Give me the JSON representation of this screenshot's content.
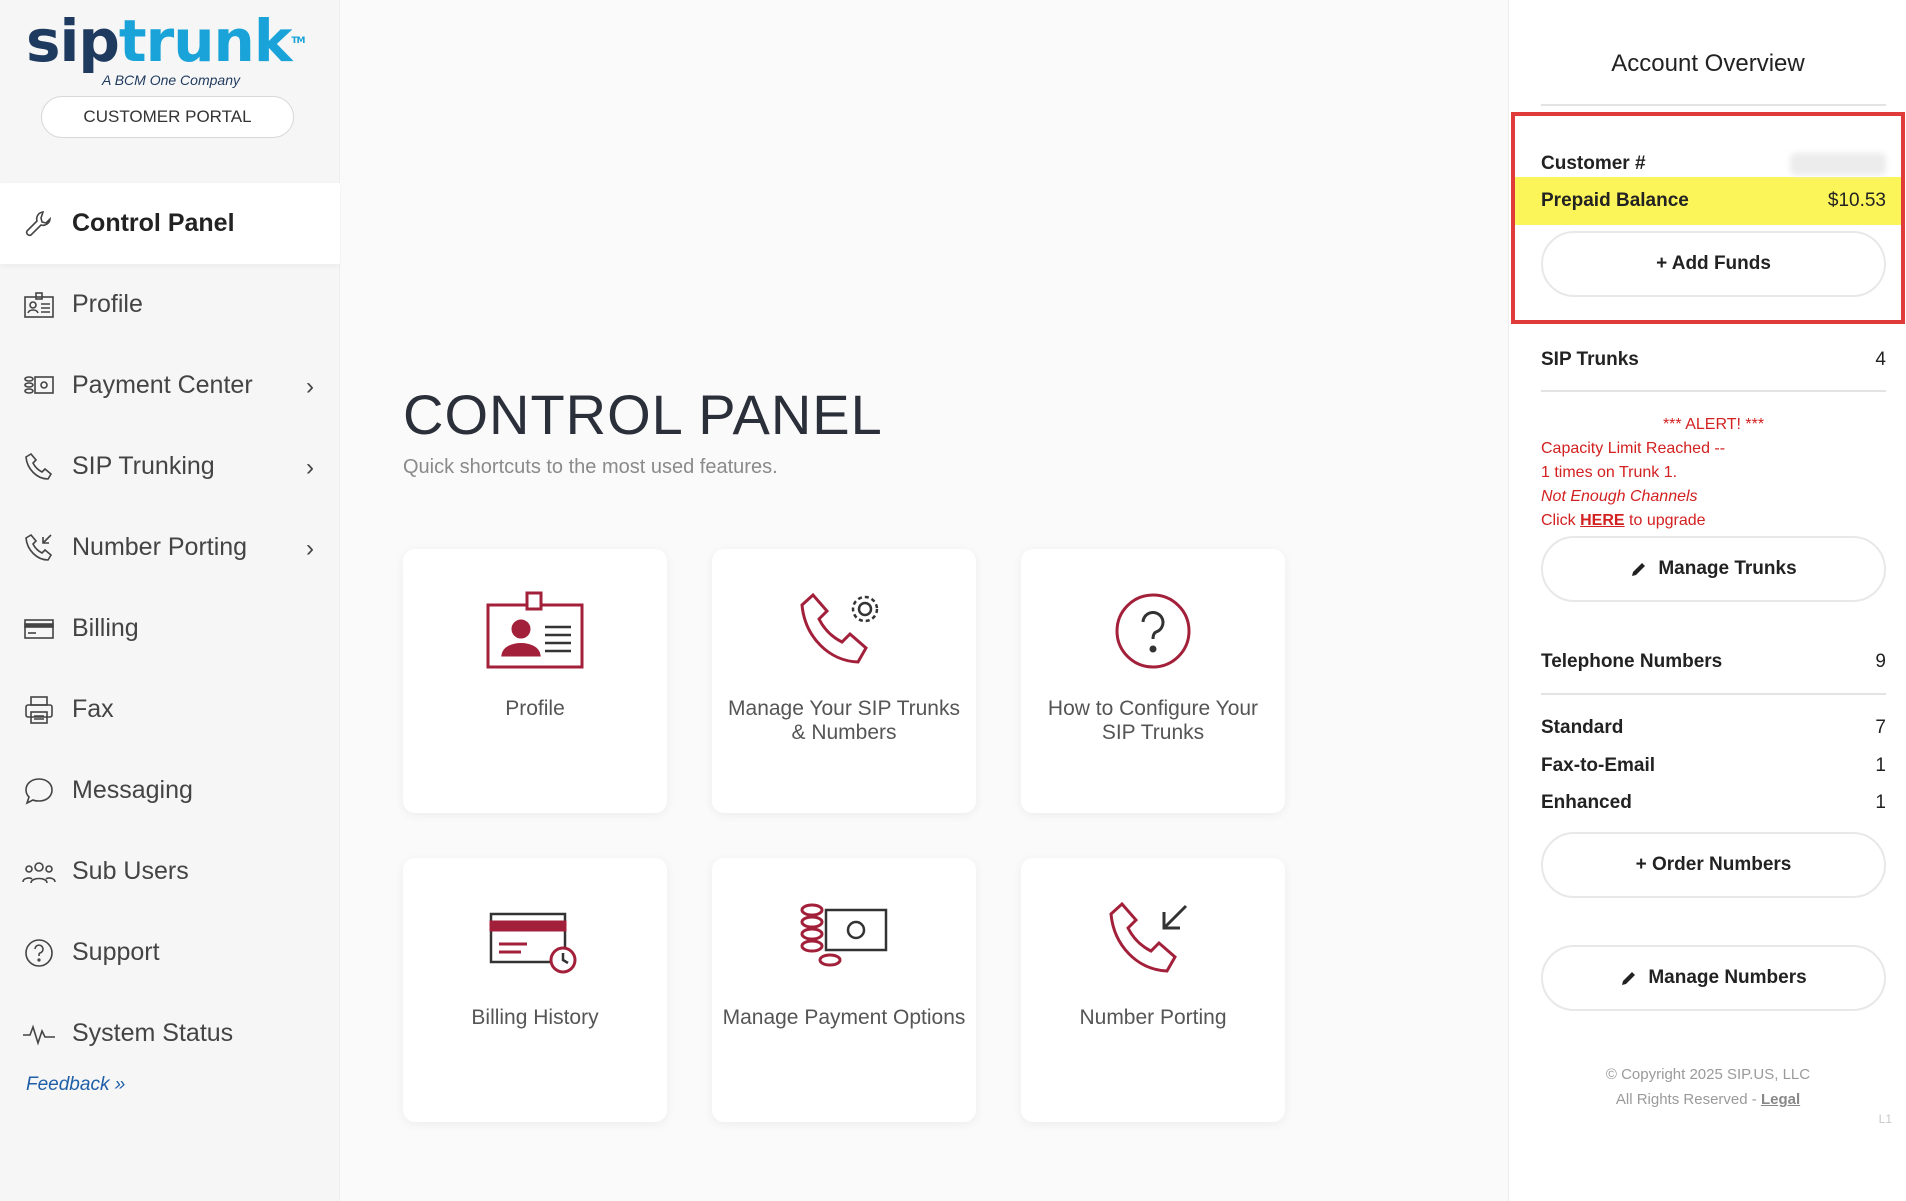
{
  "brand": {
    "name_sip": "sip",
    "name_trunk": "trunk",
    "tm": "TM",
    "tagline": "A BCM One Company"
  },
  "portal_button": "CUSTOMER PORTAL",
  "sidebar": {
    "items": [
      {
        "label": "Control Panel",
        "icon": "wrench-icon"
      },
      {
        "label": "Profile",
        "icon": "id-card-icon"
      },
      {
        "label": "Payment Center",
        "icon": "payment-icon"
      },
      {
        "label": "SIP Trunking",
        "icon": "phone-icon"
      },
      {
        "label": "Number Porting",
        "icon": "phone-incoming-icon"
      },
      {
        "label": "Billing",
        "icon": "credit-card-icon"
      },
      {
        "label": "Fax",
        "icon": "printer-icon"
      },
      {
        "label": "Messaging",
        "icon": "chat-bubble-icon"
      },
      {
        "label": "Sub Users",
        "icon": "users-icon"
      },
      {
        "label": "Support",
        "icon": "question-icon"
      },
      {
        "label": "System Status",
        "icon": "pulse-icon"
      }
    ],
    "chevron": "›",
    "feedback": "Feedback »"
  },
  "main": {
    "title": "CONTROL PANEL",
    "subtitle": "Quick shortcuts to the most used features.",
    "cards": [
      {
        "label": "Profile",
        "icon": "id-card-icon"
      },
      {
        "label": "Manage Your SIP Trunks & Numbers",
        "icon": "phone-gear-icon"
      },
      {
        "label": "How to Configure Your SIP Trunks",
        "icon": "question-circle-icon"
      },
      {
        "label": "Billing History",
        "icon": "card-clock-icon"
      },
      {
        "label": "Manage Payment Options",
        "icon": "coins-bill-icon"
      },
      {
        "label": "Number Porting",
        "icon": "phone-incoming-icon"
      }
    ]
  },
  "account": {
    "title": "Account Overview",
    "customer_label": "Customer #",
    "balance_label": "Prepaid Balance",
    "balance_value": "$10.53",
    "add_funds": "+ Add Funds",
    "trunks_label": "SIP Trunks",
    "trunks_value": "4",
    "alert": {
      "heading": "*** ALERT! ***",
      "line1": "Capacity Limit Reached --",
      "line2": "1 times on Trunk 1.",
      "line3": "Not Enough Channels",
      "click": "Click",
      "here": "HERE",
      "upgrade": "to upgrade"
    },
    "manage_trunks": "Manage Trunks",
    "numbers_label": "Telephone Numbers",
    "numbers_value": "9",
    "standard_label": "Standard",
    "standard_value": "7",
    "fax_label": "Fax-to-Email",
    "fax_value": "1",
    "enhanced_label": "Enhanced",
    "enhanced_value": "1",
    "order_numbers": "+ Order Numbers",
    "manage_numbers": "Manage Numbers",
    "copyright": "© Copyright 2025 SIP.US, LLC",
    "rights": "All Rights Reserved -",
    "legal": "Legal",
    "version": "L1"
  },
  "colors": {
    "accent": "#a3203a",
    "brand_dark": "#1f3a5f",
    "brand_light": "#1aa3d9",
    "highlight": "#fbf55a",
    "alert": "#d32020"
  }
}
